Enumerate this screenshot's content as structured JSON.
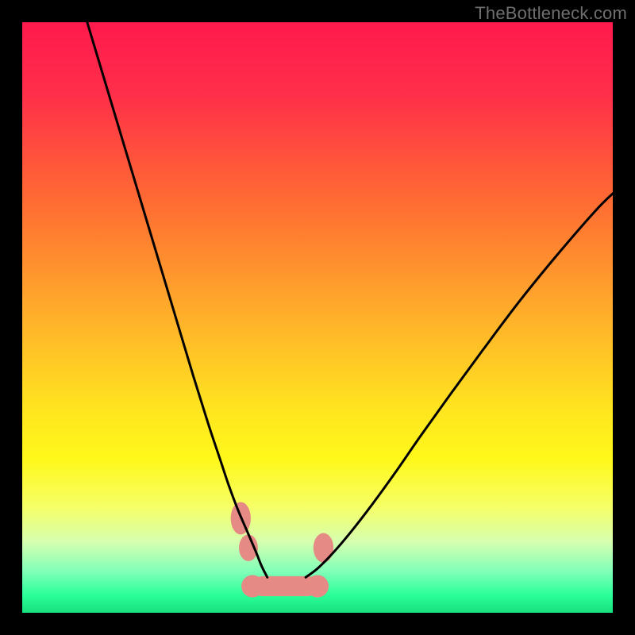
{
  "watermark": "TheBottleneck.com",
  "chart_data": {
    "type": "line",
    "title": "",
    "xlabel": "",
    "ylabel": "",
    "xlim": [
      0,
      100
    ],
    "ylim": [
      0,
      100
    ],
    "gradient_stops": [
      {
        "offset": 0.0,
        "color": "#ff1a4d"
      },
      {
        "offset": 0.12,
        "color": "#ff2e4a"
      },
      {
        "offset": 0.3,
        "color": "#ff6a33"
      },
      {
        "offset": 0.5,
        "color": "#ffb02a"
      },
      {
        "offset": 0.66,
        "color": "#ffe61f"
      },
      {
        "offset": 0.74,
        "color": "#fff81a"
      },
      {
        "offset": 0.82,
        "color": "#f6ff66"
      },
      {
        "offset": 0.88,
        "color": "#d6ffb0"
      },
      {
        "offset": 0.93,
        "color": "#80ffb8"
      },
      {
        "offset": 0.97,
        "color": "#2aff9a"
      },
      {
        "offset": 1.0,
        "color": "#19e07d"
      }
    ],
    "series": [
      {
        "name": "curve-left",
        "x": [
          11.0,
          14.0,
          17.0,
          20.0,
          23.0,
          26.0,
          29.0,
          31.5,
          33.5,
          35.0,
          36.5,
          38.0,
          39.5,
          40.5,
          41.5
        ],
        "y": [
          100.0,
          90.0,
          80.0,
          70.0,
          60.0,
          50.0,
          40.0,
          32.0,
          26.0,
          21.5,
          17.5,
          14.0,
          10.5,
          8.0,
          6.0
        ]
      },
      {
        "name": "curve-right",
        "x": [
          48.0,
          50.0,
          52.5,
          55.5,
          59.0,
          63.0,
          67.5,
          72.5,
          78.0,
          84.0,
          90.5,
          97.0,
          100.0
        ],
        "y": [
          6.0,
          7.5,
          10.0,
          13.5,
          18.0,
          23.5,
          30.0,
          37.0,
          44.5,
          52.5,
          60.5,
          68.0,
          71.0
        ]
      }
    ],
    "wiggles": [
      {
        "name": "wiggle-left-upper",
        "cx": 37.0,
        "cy": 16.0,
        "w": 3.4,
        "h": 5.5
      },
      {
        "name": "wiggle-left-lower",
        "cx": 38.3,
        "cy": 11.0,
        "w": 3.2,
        "h": 4.5
      },
      {
        "name": "wiggle-right",
        "cx": 51.0,
        "cy": 11.0,
        "w": 3.4,
        "h": 5.0
      }
    ],
    "bottom_band": {
      "x_start": 39.0,
      "x_end": 50.0,
      "y": 4.5,
      "thickness": 3.4
    },
    "accent_color": "#e58a84",
    "curve_color": "#000000"
  }
}
